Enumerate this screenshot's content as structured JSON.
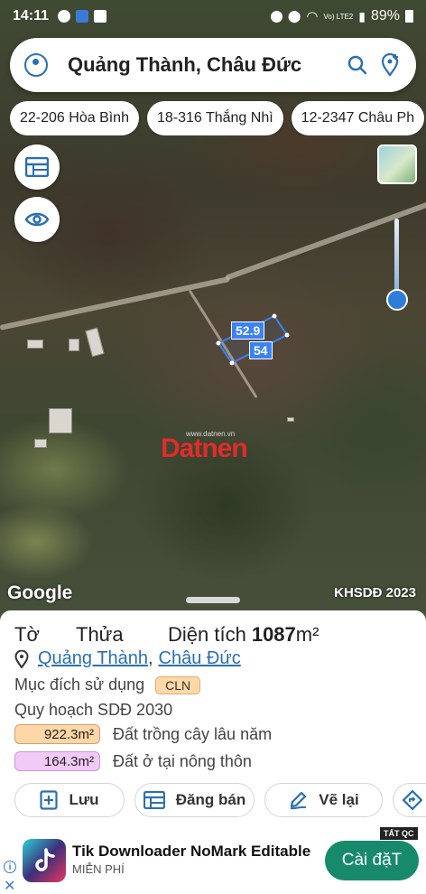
{
  "status": {
    "time": "14:11",
    "network": "Vo) LTE2",
    "battery": "89%"
  },
  "search": {
    "query": "Quảng Thành, Châu Đức"
  },
  "chips": [
    "22-206 Hòa Bình",
    "18-316 Thắng Nhì",
    "12-2347 Châu Ph"
  ],
  "map": {
    "parcel_edge_top": "52.9",
    "parcel_edge_side": "54",
    "watermark": "Datnen",
    "watermark_sub": "www.datnen.vn",
    "provider": "Google",
    "layer_label": "KHSDĐ 2023"
  },
  "sheet": {
    "to_label": "Tờ",
    "thua_label": "Thửa",
    "area_label": "Diện tích",
    "area_value": "1087",
    "area_unit": "m²",
    "location_commune": "Quảng Thành",
    "location_sep": ",",
    "location_district": "Châu Đức",
    "purpose_label": "Mục đích sử dụng",
    "purpose_code": "CLN",
    "plan_label": "Quy hoạch SDĐ 2030",
    "plans": [
      {
        "area": "922.3m²",
        "use": "Đất trồng cây lâu năm",
        "color": "#ffd6a5"
      },
      {
        "area": "164.3m²",
        "use": "Đất ở tại nông thôn",
        "color": "#f2c9f7"
      }
    ],
    "buttons": {
      "save": "Lưu",
      "post": "Đăng bán",
      "redraw": "Vẽ lại"
    }
  },
  "ad": {
    "title": "Tik Downloader NoMark Editable",
    "subtitle": "MIỄN PHÍ",
    "install": "Cài đặT",
    "tag": "TẤT QC",
    "info": "i",
    "close": "✕"
  },
  "colors": {
    "accent": "#2a6fb3",
    "install": "#178a6b",
    "parcel": "#3b82f6",
    "watermark": "#e32b2b"
  }
}
